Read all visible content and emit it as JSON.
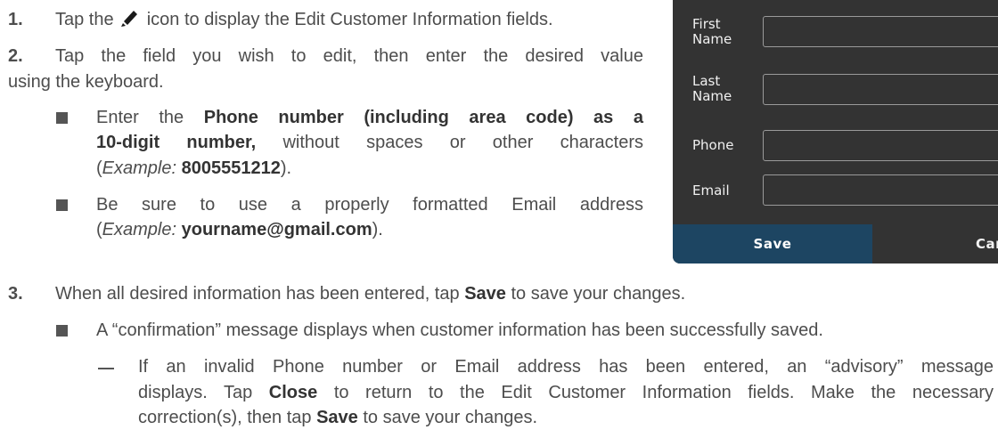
{
  "steps": [
    {
      "number": "1.",
      "text_before_icon": "Tap the",
      "icon": "pencil-icon",
      "text_after_icon": "icon to display the Edit Customer Information fields."
    },
    {
      "number": "2.",
      "line1": "Tap the field you wish to edit, then enter the desired value",
      "line2": "using the keyboard.",
      "bullets": [
        {
          "line1_pre": "Enter the",
          "line1_bold": "Phone number (including area code) as a",
          "line2_bold": "10-digit number,",
          "line2_rest": "without spaces or other characters",
          "line3_paren_open": "(",
          "line3_italic": "Example:",
          "line3_bold": "8005551212",
          "line3_close": ")."
        },
        {
          "line1": "Be sure to use a properly formatted Email address",
          "line2_paren_open": "(",
          "line2_italic": "Example:",
          "line2_bold": "yourname@gmail.com",
          "line2_close": ")."
        }
      ]
    },
    {
      "number": "3.",
      "text_pre": "When all desired information has been entered, tap",
      "text_bold": "Save",
      "text_post": "to save your changes.",
      "bullet": {
        "text": "A “confirmation” message displays when customer information has been successfully saved."
      },
      "subnote": {
        "line1": "If an invalid Phone number or Email address has been entered, an “advisory” message",
        "line2_pre": "displays. Tap",
        "line2_bold": "Close",
        "line2_post": "to return to the Edit Customer Information fields. Make the necessary",
        "line3_pre": "correction(s), then tap",
        "line3_bold": "Save",
        "line3_post": "to save your changes."
      }
    }
  ],
  "form": {
    "fields": [
      {
        "label_line1": "First",
        "label_line2": "Name",
        "value": ""
      },
      {
        "label_line1": "Last",
        "label_line2": "Name",
        "value": ""
      },
      {
        "label_line1": "Phone",
        "label_line2": "",
        "value": ""
      },
      {
        "label_line1": "Email",
        "label_line2": "",
        "value": ""
      }
    ],
    "save_label": "Save",
    "cancel_label": "Cance"
  },
  "colors": {
    "panel_bg": "#333333",
    "save_button_bg": "#1d4562",
    "body_text": "#4d4d4d"
  }
}
